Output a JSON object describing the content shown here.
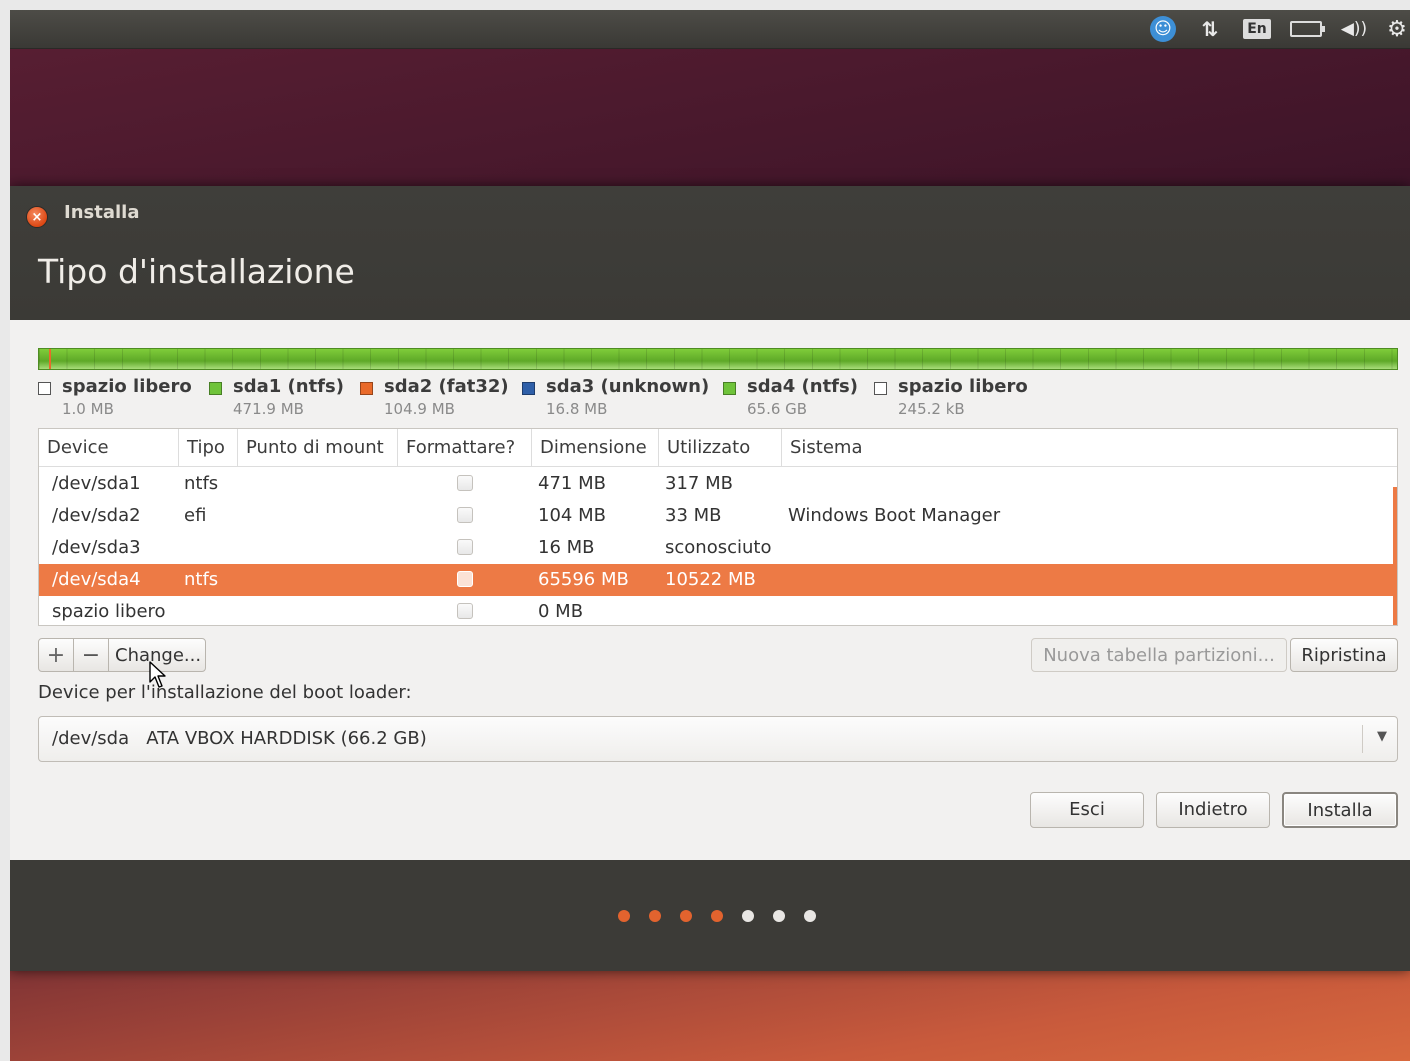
{
  "panel": {
    "keyboard_indicator": "En",
    "icons": [
      "accessibility-icon",
      "network-icon",
      "keyboard-indicator",
      "battery-icon",
      "volume-icon",
      "gear-icon"
    ]
  },
  "window": {
    "title": "Installa",
    "page_title": "Tipo d'installazione"
  },
  "legend": [
    {
      "label": "spazio libero",
      "size": "1.0 MB",
      "color": "#ffffff"
    },
    {
      "label": "sda1 (ntfs)",
      "size": "471.9 MB",
      "color": "#6fc33a"
    },
    {
      "label": "sda2 (fat32)",
      "size": "104.9 MB",
      "color": "#e96a2a"
    },
    {
      "label": "sda3 (unknown)",
      "size": "16.8 MB",
      "color": "#2f5fa8"
    },
    {
      "label": "sda4 (ntfs)",
      "size": "65.6 GB",
      "color": "#6fc33a"
    },
    {
      "label": "spazio libero",
      "size": "245.2 kB",
      "color": "#ffffff"
    }
  ],
  "table": {
    "headers": [
      "Device",
      "Tipo",
      "Punto di mount",
      "Formattare?",
      "Dimensione",
      "Utilizzato",
      "Sistema"
    ],
    "rows": [
      {
        "device": "/dev/sda1",
        "type": "ntfs",
        "mount": "",
        "size": "471 MB",
        "used": "317 MB",
        "system": ""
      },
      {
        "device": "/dev/sda2",
        "type": "efi",
        "mount": "",
        "size": "104 MB",
        "used": "33 MB",
        "system": "Windows Boot Manager"
      },
      {
        "device": "/dev/sda3",
        "type": "",
        "mount": "",
        "size": "16 MB",
        "used": "sconosciuto",
        "system": ""
      },
      {
        "device": "/dev/sda4",
        "type": "ntfs",
        "mount": "",
        "size": "65596 MB",
        "used": "10522 MB",
        "system": ""
      },
      {
        "device": "spazio libero",
        "type": "",
        "mount": "",
        "size": "0 MB",
        "used": "",
        "system": ""
      }
    ],
    "selected_row": 3
  },
  "toolbar": {
    "add_label": "+",
    "remove_label": "−",
    "change_label": "Change...",
    "new_table_label": "Nuova tabella partizioni...",
    "revert_label": "Ripristina"
  },
  "bootloader": {
    "label": "Device per l'installazione del boot loader:",
    "value": "/dev/sda   ATA VBOX HARDDISK (66.2 GB)"
  },
  "actions": {
    "quit_label": "Esci",
    "back_label": "Indietro",
    "install_label": "Installa"
  },
  "progress": {
    "total_steps": 7,
    "completed_steps": 4,
    "done_color": "#e2632e",
    "todo_color": "#e8e6e3"
  },
  "colors": {
    "accent": "#ed7a45",
    "titlebar": "#3c3b37"
  }
}
